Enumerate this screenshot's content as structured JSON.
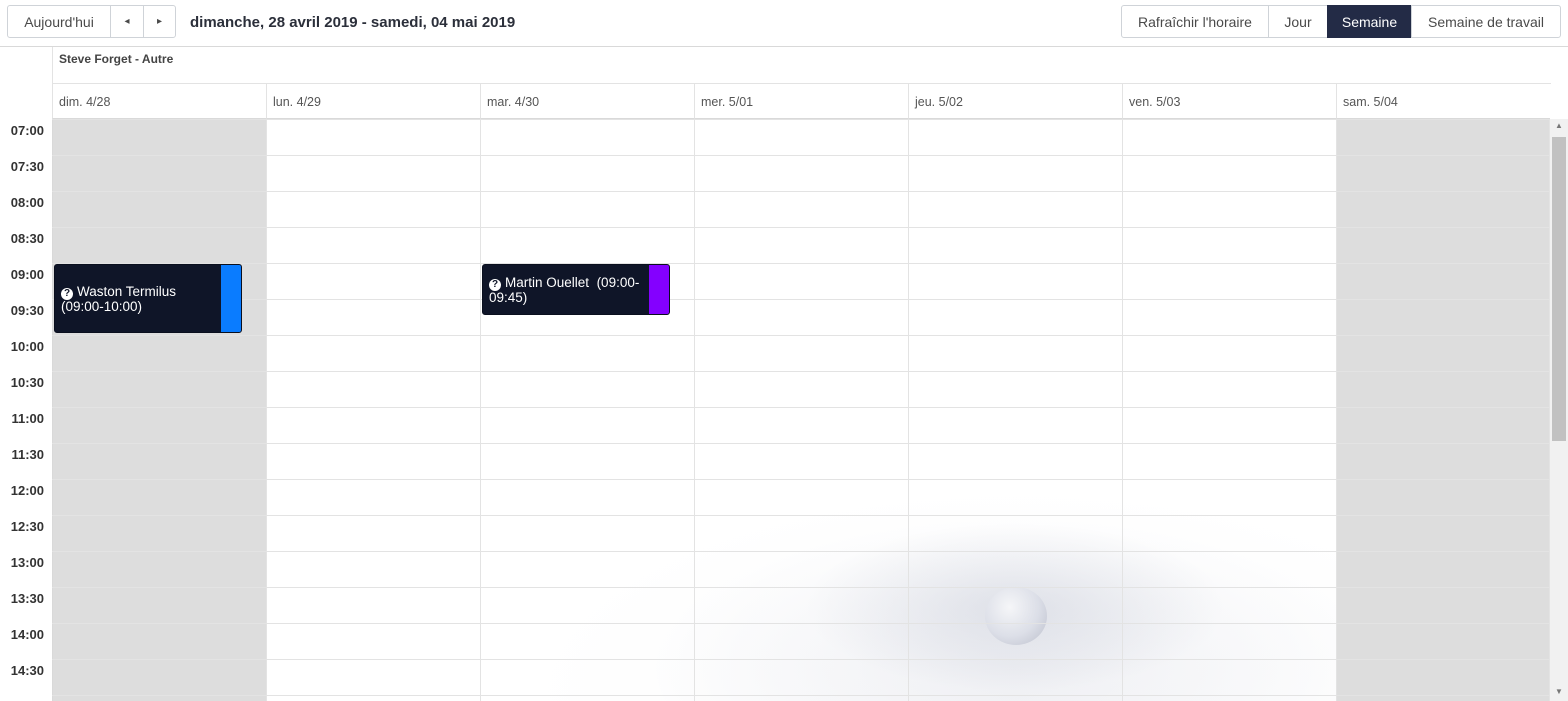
{
  "toolbar": {
    "today_label": "Aujourd'hui",
    "prev_icon": "◂",
    "next_icon": "▸",
    "range_title": "dimanche, 28 avril 2019 - samedi, 04 mai 2019",
    "refresh_label": "Rafraîchir l'horaire",
    "day_label": "Jour",
    "week_label": "Semaine",
    "workweek_label": "Semaine de travail",
    "active_view": "Semaine",
    "active_color": "#232b46"
  },
  "calendar": {
    "owner": "Steve Forget - Autre",
    "days": [
      {
        "label": "dim. 4/28",
        "weekend": true
      },
      {
        "label": "lun. 4/29",
        "weekend": false
      },
      {
        "label": "mar. 4/30",
        "weekend": false
      },
      {
        "label": "mer. 5/01",
        "weekend": false
      },
      {
        "label": "jeu. 5/02",
        "weekend": false
      },
      {
        "label": "ven. 5/03",
        "weekend": false
      },
      {
        "label": "sam. 5/04",
        "weekend": true
      }
    ],
    "times": [
      "07:00",
      "07:30",
      "08:00",
      "08:30",
      "09:00",
      "09:30",
      "10:00",
      "10:30",
      "11:00",
      "11:30",
      "12:00",
      "12:30",
      "13:00",
      "13:30",
      "14:00",
      "14:30"
    ],
    "events": [
      {
        "title": "Waston Termilus",
        "time": "(09:00-10:00)",
        "color": "#0a7cff",
        "icon": "question-icon"
      },
      {
        "title": "Martin Ouellet",
        "time": "(09:00-09:45)",
        "color": "#8400ff",
        "icon": "question-icon"
      }
    ]
  },
  "scrollbar": {
    "up_icon": "▲",
    "down_icon": "▼"
  }
}
